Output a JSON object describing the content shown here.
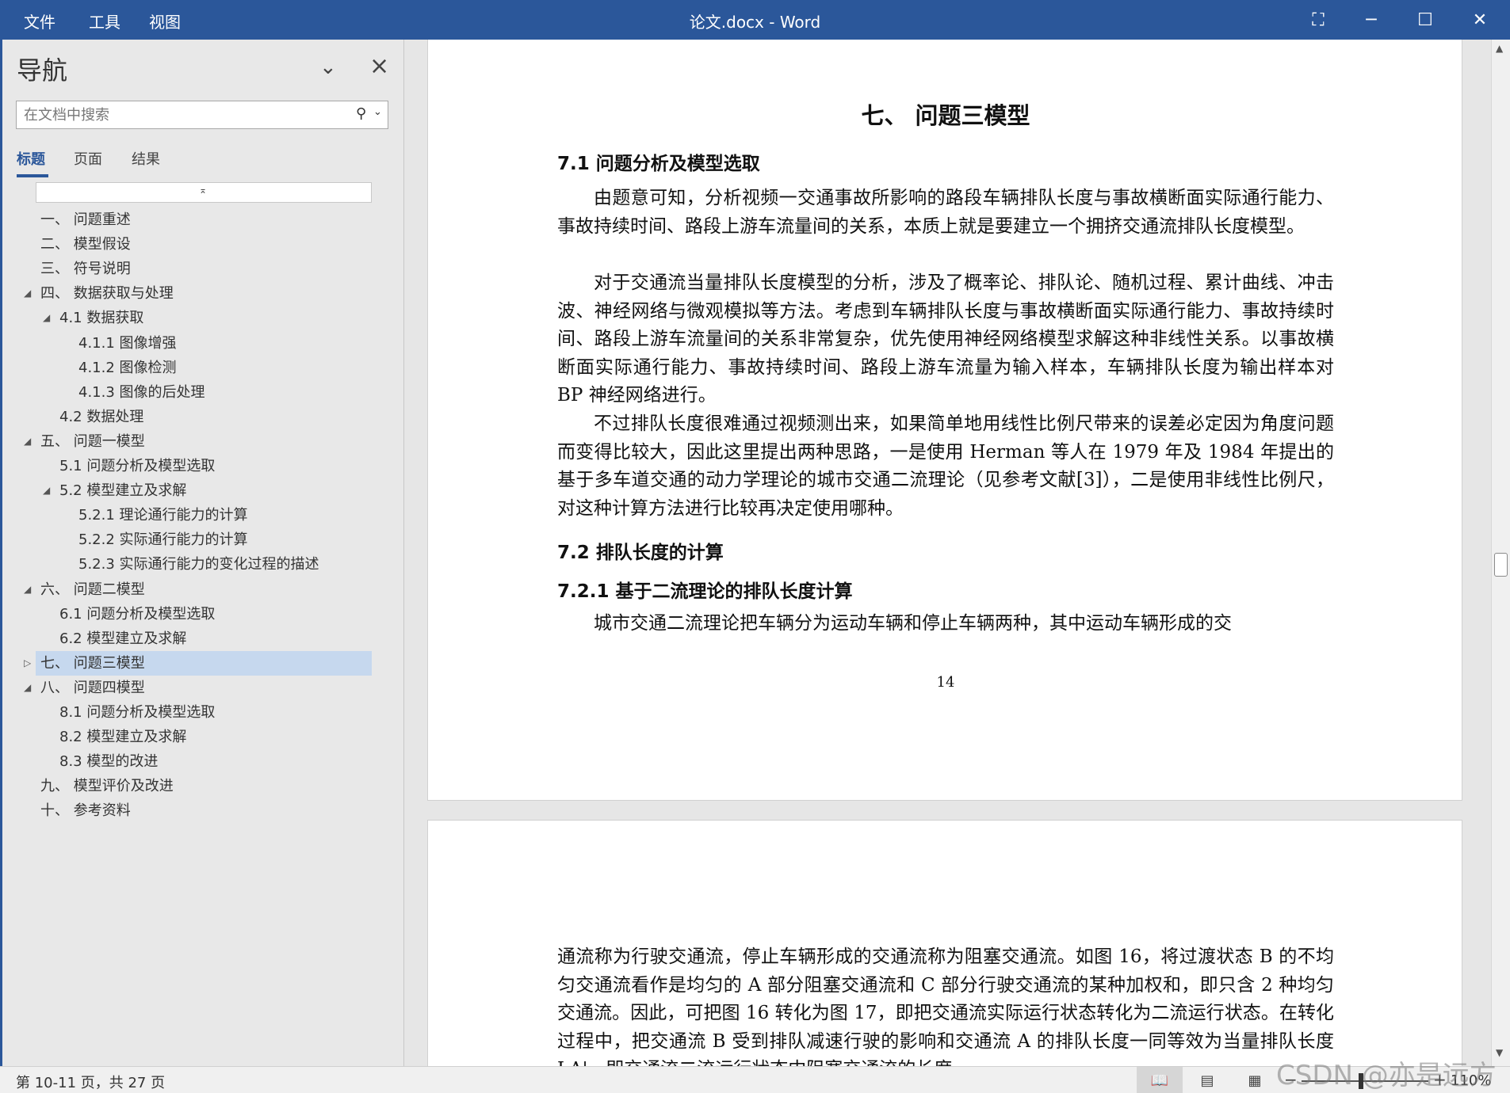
{
  "titlebar": {
    "menu": [
      "文件",
      "工具",
      "视图"
    ],
    "title": "论文.docx - Word"
  },
  "nav": {
    "title": "导航",
    "search_placeholder": "在文档中搜索",
    "tabs": [
      "标题",
      "页面",
      "结果"
    ],
    "active_tab": "标题",
    "headings": [
      {
        "text": "一、 问题重述",
        "level": 1,
        "toggle": "none"
      },
      {
        "text": "二、 模型假设",
        "level": 1,
        "toggle": "none"
      },
      {
        "text": "三、 符号说明",
        "level": 1,
        "toggle": "none"
      },
      {
        "text": "四、 数据获取与处理",
        "level": 1,
        "toggle": "expanded"
      },
      {
        "text": "4.1 数据获取",
        "level": 2,
        "toggle": "expanded"
      },
      {
        "text": "4.1.1 图像增强",
        "level": 3,
        "toggle": "none"
      },
      {
        "text": "4.1.2 图像检测",
        "level": 3,
        "toggle": "none"
      },
      {
        "text": "4.1.3 图像的后处理",
        "level": 3,
        "toggle": "none"
      },
      {
        "text": "4.2 数据处理",
        "level": 2,
        "toggle": "none"
      },
      {
        "text": "五、 问题一模型",
        "level": 1,
        "toggle": "expanded"
      },
      {
        "text": "5.1 问题分析及模型选取",
        "level": 2,
        "toggle": "none"
      },
      {
        "text": "5.2 模型建立及求解",
        "level": 2,
        "toggle": "expanded"
      },
      {
        "text": "5.2.1 理论通行能力的计算",
        "level": 3,
        "toggle": "none"
      },
      {
        "text": "5.2.2 实际通行能力的计算",
        "level": 3,
        "toggle": "none"
      },
      {
        "text": "5.2.3 实际通行能力的变化过程的描述",
        "level": 3,
        "toggle": "none"
      },
      {
        "text": "六、 问题二模型",
        "level": 1,
        "toggle": "expanded"
      },
      {
        "text": "6.1 问题分析及模型选取",
        "level": 2,
        "toggle": "none"
      },
      {
        "text": "6.2 模型建立及求解",
        "level": 2,
        "toggle": "none"
      },
      {
        "text": "七、 问题三模型",
        "level": 1,
        "toggle": "collapsed",
        "selected": true
      },
      {
        "text": "八、 问题四模型",
        "level": 1,
        "toggle": "expanded"
      },
      {
        "text": "8.1 问题分析及模型选取",
        "level": 2,
        "toggle": "none"
      },
      {
        "text": "8.2 模型建立及求解",
        "level": 2,
        "toggle": "none"
      },
      {
        "text": "8.3 模型的改进",
        "level": 2,
        "toggle": "none"
      },
      {
        "text": "九、 模型评价及改进",
        "level": 1,
        "toggle": "none"
      },
      {
        "text": "十、 参考资料",
        "level": 1,
        "toggle": "none"
      }
    ]
  },
  "document": {
    "chapter_title": "七、 问题三模型",
    "section_7_1": "7.1 问题分析及模型选取",
    "para1": "由题意可知，分析视频一交通事故所影响的路段车辆排队长度与事故横断面实际通行能力、事故持续时间、路段上游车流量间的关系，本质上就是要建立一个拥挤交通流排队长度模型。",
    "para2": "对于交通流当量排队长度模型的分析，涉及了概率论、排队论、随机过程、累计曲线、冲击波、神经网络与微观模拟等方法。考虑到车辆排队长度与事故横断面实际通行能力、事故持续时间、路段上游车流量间的关系非常复杂，优先使用神经网络模型求解这种非线性关系。以事故横断面实际通行能力、事故持续时间、路段上游车流量为输入样本，车辆排队长度为输出样本对 BP 神经网络进行。",
    "para3": "不过排队长度很难通过视频测出来，如果简单地用线性比例尺带来的误差必定因为角度问题而变得比较大，因此这里提出两种思路，一是使用 Herman 等人在 1979 年及 1984 年提出的基于多车道交通的动力学理论的城市交通二流理论（见参考文献[3]），二是使用非线性比例尺，对这种计算方法进行比较再决定使用哪种。",
    "section_7_2": "7.2 排队长度的计算",
    "section_7_2_1": "7.2.1 基于二流理论的排队长度计算",
    "para4": "城市交通二流理论把车辆分为运动车辆和停止车辆两种，其中运动车辆形成的交",
    "page_number": "14",
    "para5": "通流称为行驶交通流，停止车辆形成的交通流称为阻塞交通流。如图 16，将过渡状态 B 的不均匀交通流看作是均匀的 A 部分阻塞交通流和 C 部分行驶交通流的某种加权和，即只含 2 种均匀交通流。因此，可把图 16 转化为图 17，即把交通流实际运行状态转化为二流运行状态。在转化过程中，把交通流 B 受到排队减速行驶的影响和交通流 A 的排队长度一同等效为当量排队长度 LA'，即交通流二流运行状态中阻塞交通流的长度"
  },
  "statusbar": {
    "pages": "第 10-11 页，共 27 页",
    "zoom": "110%"
  },
  "watermark": "CSDN @亦是远方",
  "colors": {
    "titlebar": "#2b579a",
    "selected_heading": "#c6d8ee"
  }
}
